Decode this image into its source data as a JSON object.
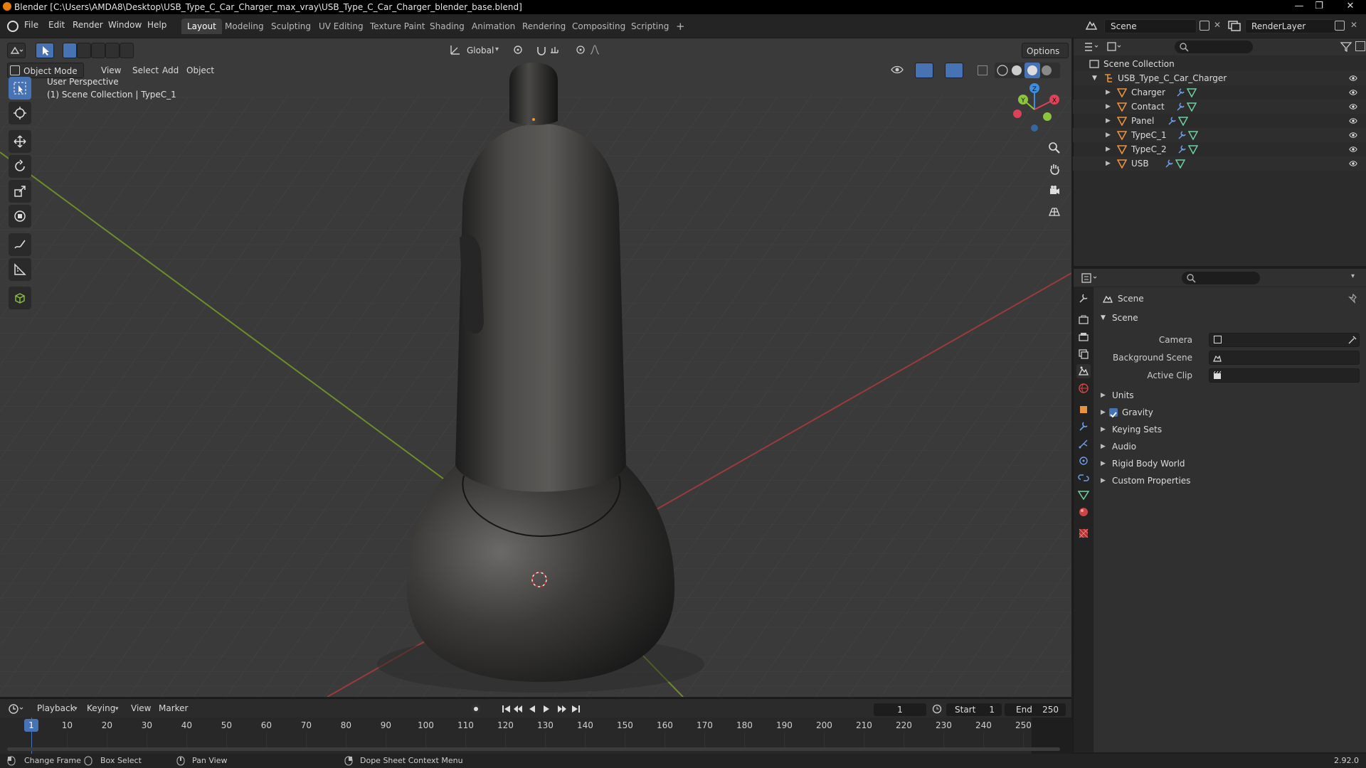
{
  "window": {
    "title": "Blender [C:\\Users\\AMDA8\\Desktop\\USB_Type_C_Car_Charger_max_vray\\USB_Type_C_Car_Charger_blender_base.blend]"
  },
  "menu": {
    "file": "File",
    "edit": "Edit",
    "render": "Render",
    "window": "Window",
    "help": "Help"
  },
  "workspaces": [
    "Layout",
    "Modeling",
    "Sculpting",
    "UV Editing",
    "Texture Paint",
    "Shading",
    "Animation",
    "Rendering",
    "Compositing",
    "Scripting"
  ],
  "workspace_add": "+",
  "scene_selector": "Scene",
  "view_layer": "RenderLayer",
  "viewport": {
    "mode": "Object Mode",
    "menus": [
      "View",
      "Select",
      "Add",
      "Object"
    ],
    "transform_orientation": "Global",
    "options": "Options",
    "info_line1": "User Perspective",
    "info_line2": "(1) Scene Collection | TypeC_1",
    "gizmo": {
      "x": "X",
      "y": "Y",
      "z": "Z"
    }
  },
  "outliner": {
    "root": "Scene Collection",
    "collection": "USB_Type_C_Car_Charger",
    "objects": [
      "Charger",
      "Contact",
      "Panel",
      "TypeC_1",
      "TypeC_2",
      "USB"
    ]
  },
  "properties": {
    "context_title": "Scene",
    "panel_title": "Scene",
    "camera_label": "Camera",
    "background_scene_label": "Background Scene",
    "active_clip_label": "Active Clip",
    "subpanels": [
      "Units",
      "Gravity",
      "Keying Sets",
      "Audio",
      "Rigid Body World",
      "Custom Properties"
    ],
    "gravity_enabled": true
  },
  "timeline": {
    "menus": [
      "Playback",
      "Keying",
      "View",
      "Marker"
    ],
    "current_frame": "1",
    "start_label": "Start",
    "start": "1",
    "end_label": "End",
    "end": "250",
    "ticks": [
      "1",
      "10",
      "20",
      "30",
      "40",
      "50",
      "60",
      "70",
      "80",
      "90",
      "100",
      "110",
      "120",
      "130",
      "140",
      "150",
      "160",
      "170",
      "180",
      "190",
      "200",
      "210",
      "220",
      "230",
      "240",
      "250"
    ]
  },
  "statusbar": {
    "change_frame": "Change Frame",
    "box_select": "Box Select",
    "pan_view": "Pan View",
    "context_menu": "Dope Sheet Context Menu",
    "version": "2.92.0"
  },
  "colors": {
    "accent": "#4772b3",
    "x_axis": "#e0415a",
    "y_axis": "#8cc43c",
    "z_axis": "#3d8ee0",
    "object_orange": "#e8923d"
  }
}
